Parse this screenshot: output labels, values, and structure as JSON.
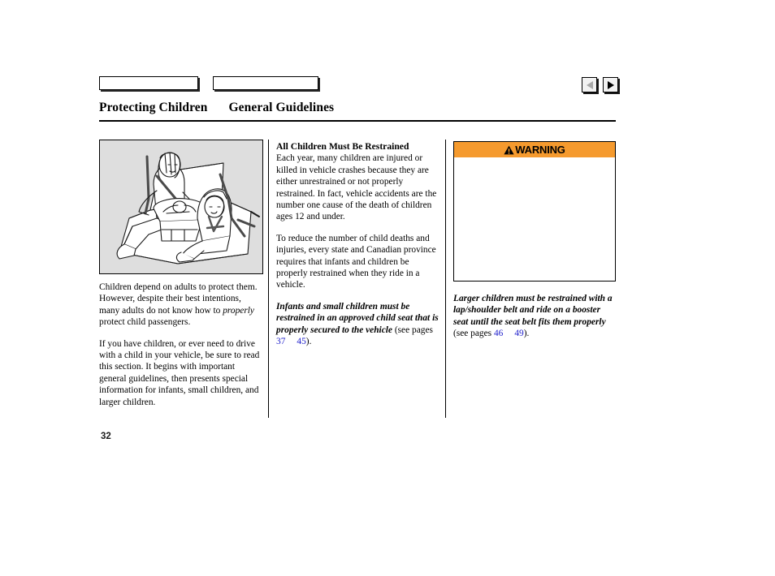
{
  "document": {
    "page_number": "32",
    "title_main": "Protecting Children",
    "title_sub": "General Guidelines"
  },
  "tabs": [
    {
      "name": "tab-1",
      "label": ""
    },
    {
      "name": "tab-2",
      "label": ""
    }
  ],
  "navigation": {
    "prev_icon": "triangle-left-icon",
    "next_icon": "triangle-right-icon"
  },
  "left_column": {
    "illustration_alt": "rear-seat-occupants-illustration",
    "caption_part1": "Children depend on adults to protect them. However, despite their best intentions, many adults do not know how to ",
    "caption_italic": "properly",
    "caption_part2": " protect child passengers.",
    "paragraph2": "If you have children, or ever need to drive with a child in your vehicle, be sure to read this section. It begins with important general guidelines, then presents special information for infants, small children, and larger children."
  },
  "middle_column": {
    "heading": "All Children Must Be Restrained",
    "paragraph1": "Each year, many children are injured or killed in vehicle crashes because they are either unrestrained or not properly restrained. In fact, vehicle accidents are the number one cause of the death of children ages 12 and under.",
    "paragraph2": "To reduce the number of child deaths and injuries, every state and Canadian province requires that infants and children be properly restrained when they ride in a vehicle.",
    "emphasis": "Infants and small children must be restrained in an approved child seat that is properly secured to the vehicle",
    "see_pages_prefix": " (see pages ",
    "page_link_1": "37",
    "page_link_2": "45",
    "see_pages_suffix": ")."
  },
  "right_column": {
    "warning_label": "WARNING",
    "warning_icon": "warning-triangle-icon",
    "warning_body_text": "",
    "emphasis": "Larger children must be restrained with a lap/shoulder belt and ride on a booster seat until the seat belt fits them properly",
    "see_pages_prefix": " (see pages ",
    "page_link_1": "46",
    "page_link_2": "49",
    "see_pages_suffix": ")."
  },
  "colors": {
    "warning_orange": "#F59A2E",
    "link_blue": "#2222cc",
    "illustration_bg": "#dedede"
  }
}
